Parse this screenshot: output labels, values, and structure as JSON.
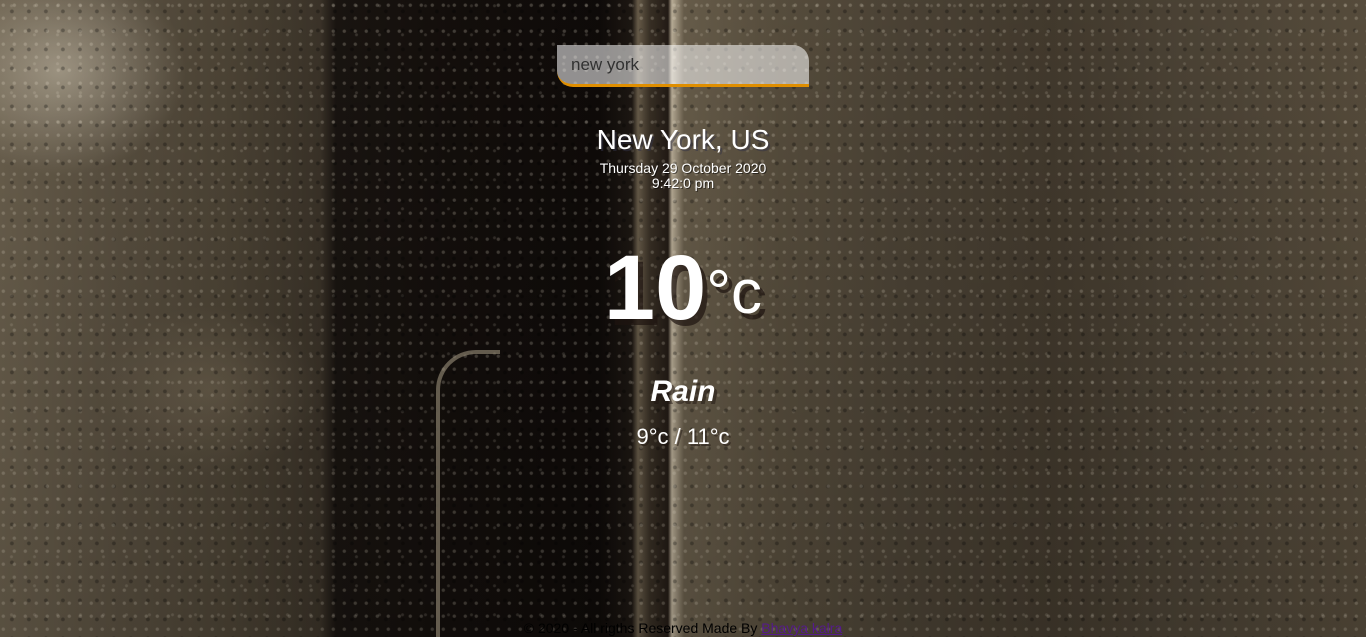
{
  "search": {
    "value": "new york",
    "placeholder": ""
  },
  "location": {
    "city_country": "New York, US"
  },
  "datetime": {
    "date": "Thursday 29 October 2020",
    "time": "9:42:0 pm"
  },
  "current": {
    "temp": "10",
    "unit": "°c",
    "weather": "Rain",
    "hi_low": "9°c / 11°c"
  },
  "footer": {
    "text": "© 2020 - All rigths Reserved Made By",
    "author_link": "Bhavya kalra"
  },
  "colors": {
    "search_accent": "#df8e00",
    "link": "#551a8b"
  }
}
